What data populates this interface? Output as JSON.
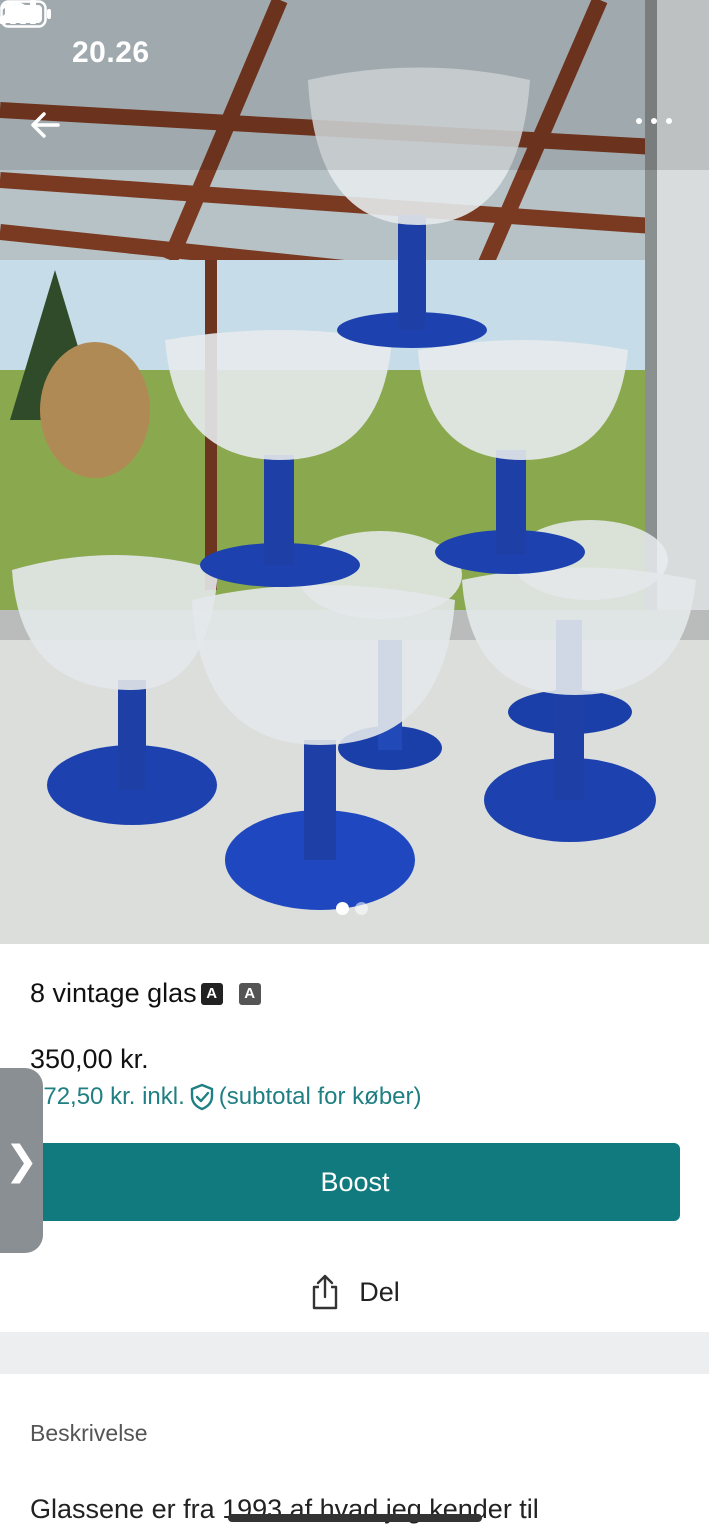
{
  "status_bar": {
    "time": "20.26",
    "person_icon": "person-icon",
    "signal_icon": "cellular-signal-icon",
    "wifi_icon": "wifi-icon",
    "battery_icon": "battery-icon"
  },
  "nav": {
    "back_icon": "arrow-left-icon",
    "more_icon": "more-dots-icon"
  },
  "gallery": {
    "page_count": 2,
    "active_page": 1
  },
  "listing": {
    "title": "8 vintage glas",
    "title_tag_1": "A",
    "title_tag_2": "A",
    "price": "350,00 kr.",
    "subtotal_amount": "372,50 kr. inkl.",
    "subtotal_note": "(subtotal for køber)",
    "boost_label": "Boost",
    "share_label": "Del",
    "side_tab_glyph": "❯"
  },
  "description": {
    "heading": "Beskrivelse",
    "text": "Glassene er fra 1993 af hvad jeg kender til"
  },
  "colors": {
    "accent": "#117a7f",
    "subtotal_text": "#1f7f82",
    "band": "#eceeef"
  }
}
